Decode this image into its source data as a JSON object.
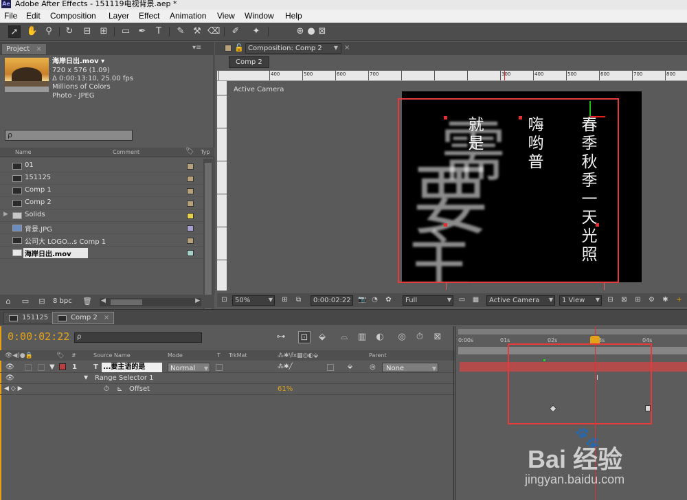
{
  "window": {
    "app_title": "Adobe After Effects - 151119电视背景.aep *"
  },
  "menu": [
    "File",
    "Edit",
    "Composition",
    "Layer",
    "Effect",
    "Animation",
    "View",
    "Window",
    "Help"
  ],
  "project": {
    "tab_label": "Project",
    "file": {
      "name": "海岸日出.mov ▾",
      "dims": "720 x 576 (1.09)",
      "duration": "Δ 0:00:13:10, 25.00 fps",
      "colors": "Millions of Colors",
      "codec": "Photo - JPEG"
    },
    "search_placeholder": "ρ",
    "columns": {
      "name": "Name",
      "comment": "Comment",
      "type": "Typ"
    },
    "items": [
      {
        "name": "01",
        "icon": "comp-icon",
        "color": "#b8a07a"
      },
      {
        "name": "151125",
        "icon": "comp-icon",
        "color": "#b8a07a"
      },
      {
        "name": "Comp 1",
        "icon": "comp-icon",
        "color": "#b8a07a"
      },
      {
        "name": "Comp 2",
        "icon": "comp-icon",
        "color": "#b8a07a"
      },
      {
        "name": "Solids",
        "icon": "folder-icon",
        "color": "#e8d24a"
      },
      {
        "name": "背景.JPG",
        "icon": "image-icon",
        "color": "#a8a0d0"
      },
      {
        "name": "公司大 LOGO...s Comp 1",
        "icon": "comp-icon",
        "color": "#b8a07a"
      },
      {
        "name": "海岸日出.mov",
        "icon": "footage-icon",
        "color": "#a8d0c8",
        "selected": true
      }
    ],
    "bpc": "8 bpc"
  },
  "composition": {
    "panel_title": "Composition: Comp 2",
    "subtab": "Comp 2",
    "viewer_label": "Active Camera",
    "ruler_labels": [
      "300",
      "400",
      "500",
      "600",
      "700",
      "800",
      "900",
      "500",
      "600",
      "700",
      "800"
    ],
    "text_lines": [
      "就是",
      "嗨哟普",
      "春季秋季一天光照"
    ],
    "big_glyphs": [
      "需",
      "要",
      "主"
    ],
    "footer": {
      "zoom": "50%",
      "timecode": "0:00:02:22",
      "resolution": "Full",
      "view": "Active Camera",
      "layout": "1 View"
    }
  },
  "timeline": {
    "tabs": [
      "151125",
      "Comp 2"
    ],
    "timecode": "0:00:02:22",
    "search_placeholder": "ρ",
    "columns": {
      "source_name": "Source Name",
      "mode": "Mode",
      "t": "T",
      "trkmat": "TrkMat",
      "parent": "Parent",
      "num": "#"
    },
    "layer": {
      "number": "1",
      "type_icon": "T",
      "name": "...要主语的是",
      "mode": "Normal",
      "parent": "None"
    },
    "range_selector": "Range Selector 1",
    "offset": {
      "label": "Offset",
      "value": "61%"
    },
    "time_labels": [
      "0:00s",
      "01s",
      "02s",
      "03s",
      "04s"
    ],
    "playhead_time_s": 2.88,
    "keyframes_s": [
      2.0,
      4.0
    ]
  },
  "watermark": {
    "brand": "Bai  经验",
    "url": "jingyan.baidu.com"
  }
}
